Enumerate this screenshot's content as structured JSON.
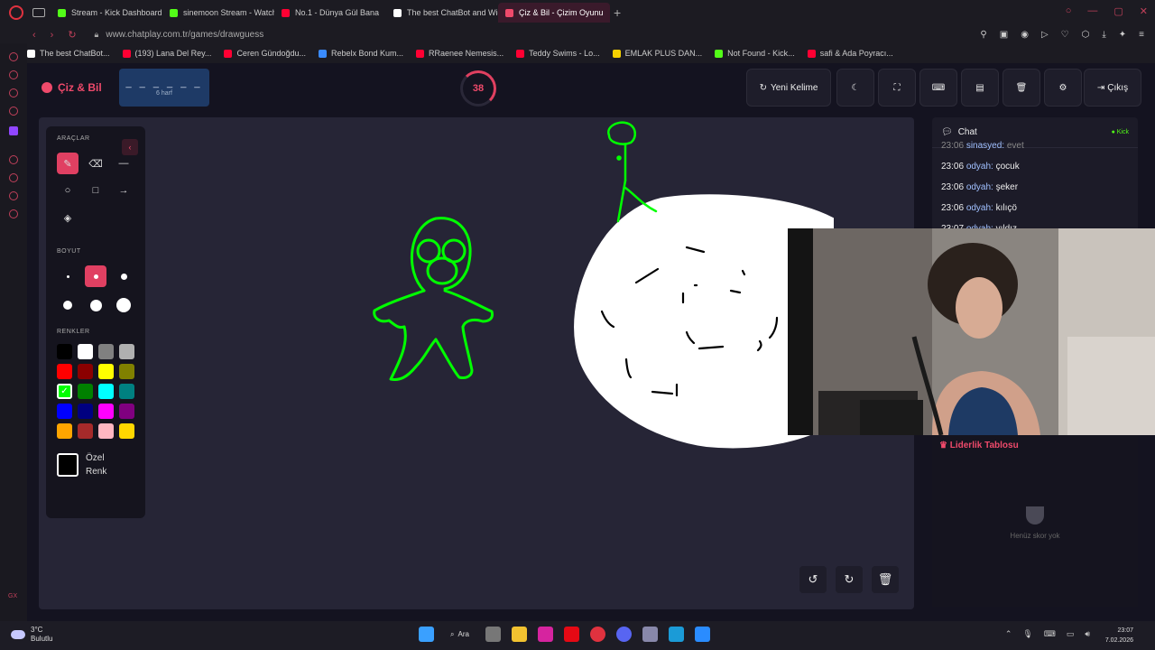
{
  "browser": {
    "tabs": [
      {
        "label": "Stream - Kick Dashboard",
        "color": "#53fc18"
      },
      {
        "label": "sinemoon Stream - Watch",
        "color": "#53fc18"
      },
      {
        "label": "No.1 - Dünya Gül Bana",
        "color": "#ff0033"
      },
      {
        "label": "The best ChatBot and Wid",
        "color": "#ffffff"
      },
      {
        "label": "Çiz & Bil - Çizim Oyunu",
        "color": "#ef4a6b"
      }
    ],
    "url": "www.chatplay.com.tr/games/drawguess",
    "bookmarks": [
      {
        "label": "The best ChatBot...",
        "color": "#ffffff"
      },
      {
        "label": "(193) Lana Del Rey...",
        "color": "#ff0033"
      },
      {
        "label": "Ceren Gündoğdu...",
        "color": "#ff0033"
      },
      {
        "label": "Rebelx Bond Kum...",
        "color": "#3a8bff"
      },
      {
        "label": "RRaenee Nemesis...",
        "color": "#ff0033"
      },
      {
        "label": "Teddy Swims - Lo...",
        "color": "#ff0033"
      },
      {
        "label": "EMLAK PLUS DAN...",
        "color": "#f5d000"
      },
      {
        "label": "Not Found - Kick...",
        "color": "#53fc18"
      },
      {
        "label": "safi & Ada Poyracı...",
        "color": "#ff0033"
      }
    ]
  },
  "header": {
    "brand": "Çiz & Bil",
    "word_dashes": "_ _ _ _ _ _",
    "word_hint": "6 harf",
    "timer": "38",
    "new_word": "Yeni Kelime",
    "exit": "Çıkış"
  },
  "tools": {
    "tools_title": "ARAÇLAR",
    "size_title": "BOYUT",
    "colors_title": "RENKLER",
    "custom_line1": "Özel",
    "custom_line2": "Renk",
    "colors": [
      "#000000",
      "#ffffff",
      "#808080",
      "#b0b0b0",
      "#ff0000",
      "#8b0000",
      "#ffff00",
      "#808000",
      "#00ff00",
      "#008000",
      "#00ffff",
      "#008080",
      "#0000ff",
      "#000080",
      "#ff00ff",
      "#800080",
      "#ffa500",
      "#a52a2a",
      "#ffb6c1",
      "#ffd700"
    ]
  },
  "chat": {
    "title": "Chat",
    "platform": "Kick",
    "messages": [
      {
        "time": "23:06",
        "user": "sinasyed:",
        "text": "evet"
      },
      {
        "time": "23:06",
        "user": "odyah:",
        "text": "çocuk"
      },
      {
        "time": "23:06",
        "user": "odyah:",
        "text": "şeker"
      },
      {
        "time": "23:06",
        "user": "odyah:",
        "text": "kılıçö"
      },
      {
        "time": "23:07",
        "user": "odyah:",
        "text": "yıldız"
      }
    ]
  },
  "leaderboard": {
    "title": "Liderlik Tablosu",
    "empty": "Henüz skor yok"
  },
  "taskbar": {
    "temp": "3°C",
    "weather": "Bulutlu",
    "search": "Ara",
    "time": "23:07",
    "date": "7.02.2026"
  }
}
